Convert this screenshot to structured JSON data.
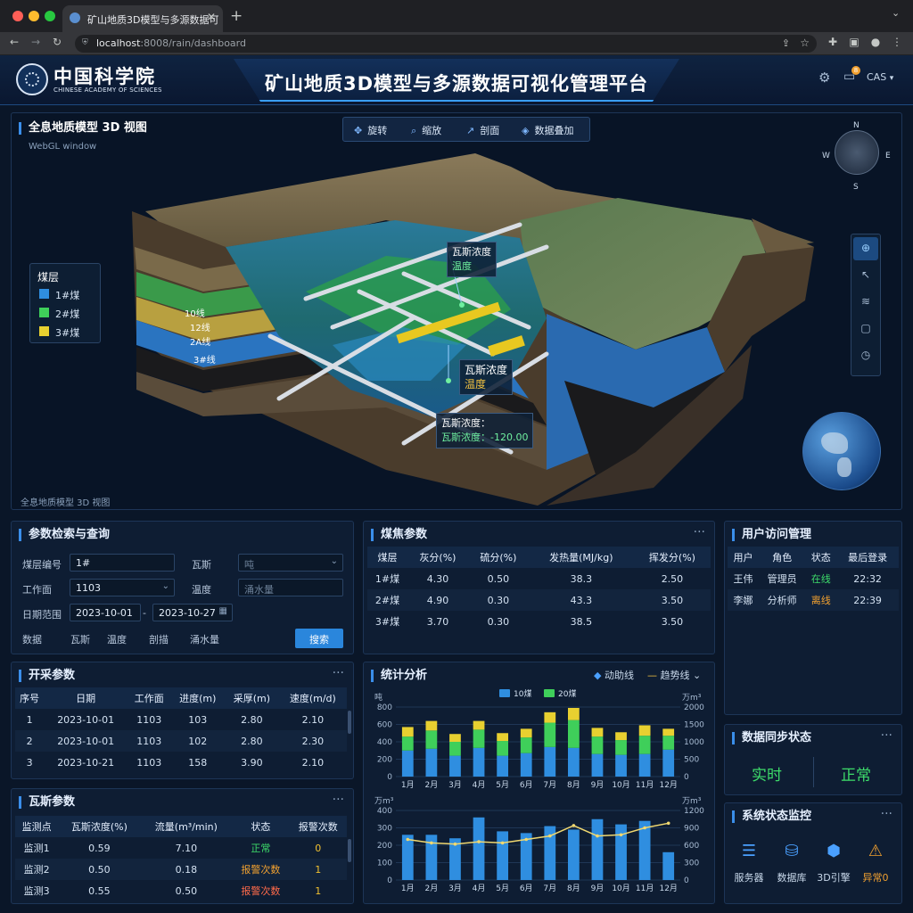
{
  "browser": {
    "tab_title": "矿山地质3D模型与多源数据可",
    "url_host": "localhost",
    "url_rest": ":8008/rain/dashboard"
  },
  "header": {
    "logo_cn": "中国科学院",
    "logo_en": "CHINESE ACADEMY OF SCIENCES",
    "title": "矿山地质3D模型与多源数据可视化管理平台",
    "user": "CAS",
    "notif_count": "8"
  },
  "viewer": {
    "title": "全息地质模型 3D 视图",
    "subtitle": "WebGL window",
    "footer": "全息地质模型 3D 视图",
    "tools": [
      {
        "icon": "rotate-icon",
        "label": "旋转"
      },
      {
        "icon": "zoom-icon",
        "label": "缩放"
      },
      {
        "icon": "section-icon",
        "label": "剖面"
      },
      {
        "icon": "layers-icon",
        "label": "数据叠加"
      }
    ],
    "compass": {
      "n": "N",
      "s": "S",
      "e": "E",
      "w": "W"
    },
    "legend": {
      "title": "煤层",
      "items": [
        {
          "label": "1#煤",
          "color": "#2f8ee0"
        },
        {
          "label": "2#煤",
          "color": "#3fcf5a"
        },
        {
          "label": "3#煤",
          "color": "#e8d030"
        }
      ]
    },
    "seam_labels": [
      "10线",
      "12线",
      "2A线",
      "3#线"
    ],
    "tips": [
      {
        "line1": "瓦斯浓度",
        "line2": "温度"
      },
      {
        "line1": "瓦斯浓度",
        "line2": "温度"
      },
      {
        "line1": "瓦斯浓度：",
        "line2": "瓦斯浓度：-120.00"
      }
    ]
  },
  "query": {
    "title": "参数检索与查询",
    "seam_label": "煤层编号",
    "seam_value": "1#",
    "gas_label": "瓦斯",
    "gas_placeholder": "吨",
    "face_label": "工作面",
    "face_value": "1103",
    "temp_label": "温度",
    "temp_placeholder": "涌水量",
    "date_label": "日期范围",
    "date_from": "2023-10-01",
    "date_sep": "-",
    "date_to": "2023-10-27",
    "tags": [
      "数据",
      "瓦斯",
      "温度",
      "剖描",
      "涌水量"
    ],
    "search_button": "搜索"
  },
  "coal": {
    "title": "煤焦参数",
    "columns": [
      "煤层",
      "灰分(%)",
      "硫分(%)",
      "发热量(MJ/kg)",
      "挥发分(%)"
    ],
    "rows": [
      [
        "1#煤",
        "4.30",
        "0.50",
        "38.3",
        "2.50"
      ],
      [
        "2#煤",
        "4.90",
        "0.30",
        "43.3",
        "3.50"
      ],
      [
        "3#煤",
        "3.70",
        "0.30",
        "38.5",
        "3.50"
      ]
    ]
  },
  "users": {
    "title": "用户访问管理",
    "columns": [
      "用户",
      "角色",
      "状态",
      "最后登录"
    ],
    "rows": [
      {
        "user": "王伟",
        "role": "管理员",
        "status": "在线",
        "status_kind": "ok",
        "last": "22:32"
      },
      {
        "user": "李娜",
        "role": "分析师",
        "status": "离线",
        "status_kind": "warn",
        "last": "22:39"
      }
    ]
  },
  "mining": {
    "title": "开采参数",
    "columns": [
      "序号",
      "日期",
      "工作面",
      "进度(m)",
      "采厚(m)",
      "速度(m/d)"
    ],
    "rows": [
      [
        "1",
        "2023-10-01",
        "1103",
        "103",
        "2.80",
        "2.10"
      ],
      [
        "2",
        "2023-10-01",
        "1103",
        "102",
        "2.80",
        "2.30"
      ],
      [
        "3",
        "2023-10-21",
        "1103",
        "158",
        "3.90",
        "2.10"
      ]
    ]
  },
  "gas": {
    "title": "瓦斯参数",
    "columns": [
      "监测点",
      "瓦斯浓度(%)",
      "流量(m³/min)",
      "状态",
      "报警次数"
    ],
    "rows": [
      {
        "point": "监测1",
        "conc": "0.59",
        "flow": "7.10",
        "status": "正常",
        "kind": "ok",
        "alarms": "0"
      },
      {
        "point": "监测2",
        "conc": "0.50",
        "flow": "0.18",
        "status": "报警次数",
        "kind": "warn",
        "alarms": "1"
      },
      {
        "point": "监测3",
        "conc": "0.55",
        "flow": "0.50",
        "status": "报警次数",
        "kind": "bad",
        "alarms": "1"
      }
    ]
  },
  "stats": {
    "title": "统计分析",
    "toggle_dynamic": "动助线",
    "toggle_trend": "趋势线"
  },
  "chart_data": [
    {
      "type": "bar",
      "categories": [
        "1月",
        "2月",
        "3月",
        "4月",
        "5月",
        "6月",
        "7月",
        "8月",
        "9月",
        "10月",
        "11月",
        "12月"
      ],
      "series": [
        {
          "name": "10煤",
          "color": "#2f8ee0",
          "values": [
            300,
            320,
            240,
            330,
            240,
            270,
            340,
            330,
            260,
            250,
            260,
            310
          ]
        },
        {
          "name": "20煤",
          "color": "#3fcf5a",
          "values": [
            160,
            210,
            160,
            210,
            170,
            180,
            280,
            320,
            200,
            170,
            210,
            160
          ]
        },
        {
          "name": "",
          "color": "#e8d030",
          "values": [
            110,
            110,
            90,
            100,
            90,
            100,
            120,
            140,
            100,
            90,
            120,
            80
          ]
        }
      ],
      "ylabel_left": "吨",
      "ylabel_right": "万m³",
      "ylim": [
        0,
        800
      ],
      "yticks_left": [
        "800",
        "600",
        "400",
        "200",
        "0"
      ],
      "yticks_right": [
        "2000",
        "1500",
        "1000",
        "500",
        "0"
      ]
    },
    {
      "type": "bar",
      "categories": [
        "1月",
        "2月",
        "3月",
        "4月",
        "5月",
        "6月",
        "7月",
        "8月",
        "9月",
        "10月",
        "11月",
        "12月"
      ],
      "series": [
        {
          "name": "",
          "color": "#2f8ee0",
          "values": [
            260,
            260,
            240,
            360,
            280,
            270,
            310,
            290,
            350,
            320,
            340,
            160
          ]
        },
        {
          "name": "",
          "color": "#f0d870",
          "type": "line",
          "values": [
            700,
            640,
            620,
            660,
            640,
            700,
            760,
            940,
            760,
            780,
            900,
            980
          ]
        }
      ],
      "ylabel_left": "万m³",
      "ylabel_right": "万m³",
      "ylim": [
        0,
        400
      ],
      "y2lim": [
        0,
        1200
      ],
      "yticks_left": [
        "400",
        "300",
        "200",
        "100",
        "0"
      ],
      "yticks_right": [
        "1200",
        "900",
        "600",
        "300",
        "0"
      ]
    }
  ],
  "sync": {
    "title": "数据同步状态",
    "left": "实时",
    "right": "正常"
  },
  "system": {
    "title": "系统状态监控",
    "items": [
      {
        "icon": "server-icon",
        "label": "服务器",
        "color": "#4aa0ff"
      },
      {
        "icon": "database-icon",
        "label": "数据库",
        "color": "#4aa0ff"
      },
      {
        "icon": "engine-icon",
        "label": "3D引擎",
        "color": "#4aa0ff"
      },
      {
        "icon": "warning-icon",
        "label": "异常0",
        "color": "#f0a030"
      }
    ]
  }
}
